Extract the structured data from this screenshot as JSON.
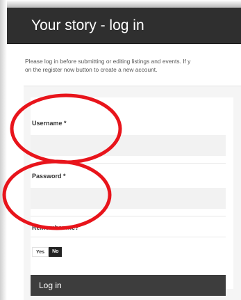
{
  "page": {
    "title": "Your story - log in",
    "intro_line1": "Please log in before submitting or editing listings and events. If y",
    "intro_line2": "on the register now button to create a new account."
  },
  "form": {
    "username_label": "Username *",
    "username_value": "",
    "password_label": "Password *",
    "password_value": "",
    "remember_label": "Remember me?",
    "remember_yes": "Yes",
    "remember_no": "No",
    "remember_selected": "No",
    "login_button": "Log in"
  },
  "annotation": {
    "color": "#e8141b",
    "circled_fields": [
      "Username *",
      "Password *"
    ]
  },
  "colors": {
    "title_bar": "#2f2f2f",
    "button": "#3d3d3d",
    "input_bg": "#f2f2f2"
  }
}
